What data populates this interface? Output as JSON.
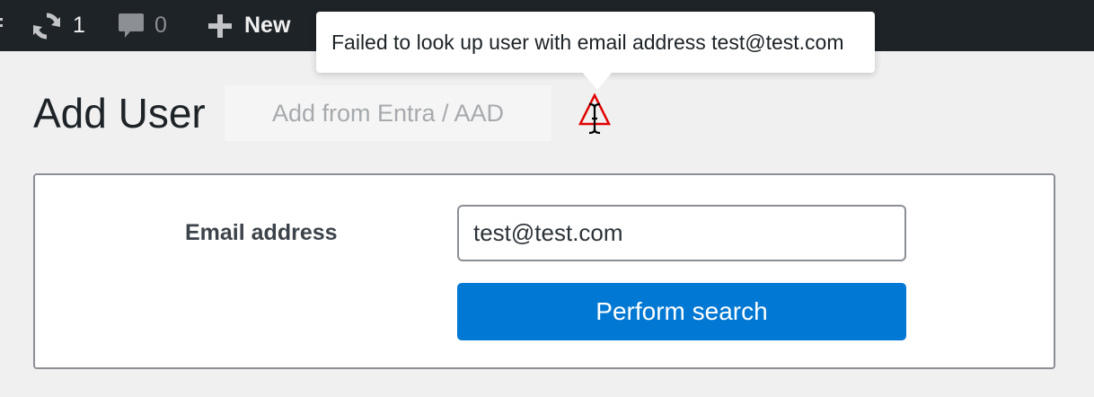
{
  "admin_bar": {
    "updates_count": "1",
    "comments_count": "0",
    "new_label": "New"
  },
  "page": {
    "title": "Add User",
    "add_from_button": "Add from Entra / AAD"
  },
  "tooltip": {
    "message": "Failed to look up user with email address test@test.com"
  },
  "form": {
    "email_label": "Email address",
    "email_value": "test@test.com",
    "search_button": "Perform search"
  },
  "colors": {
    "admin_bar": "#1d2327",
    "primary_button": "#0078d4",
    "warning": "#e00000"
  },
  "icons": [
    "updates-icon",
    "comments-icon",
    "plus-icon",
    "warning-icon",
    "text-cursor-icon"
  ]
}
